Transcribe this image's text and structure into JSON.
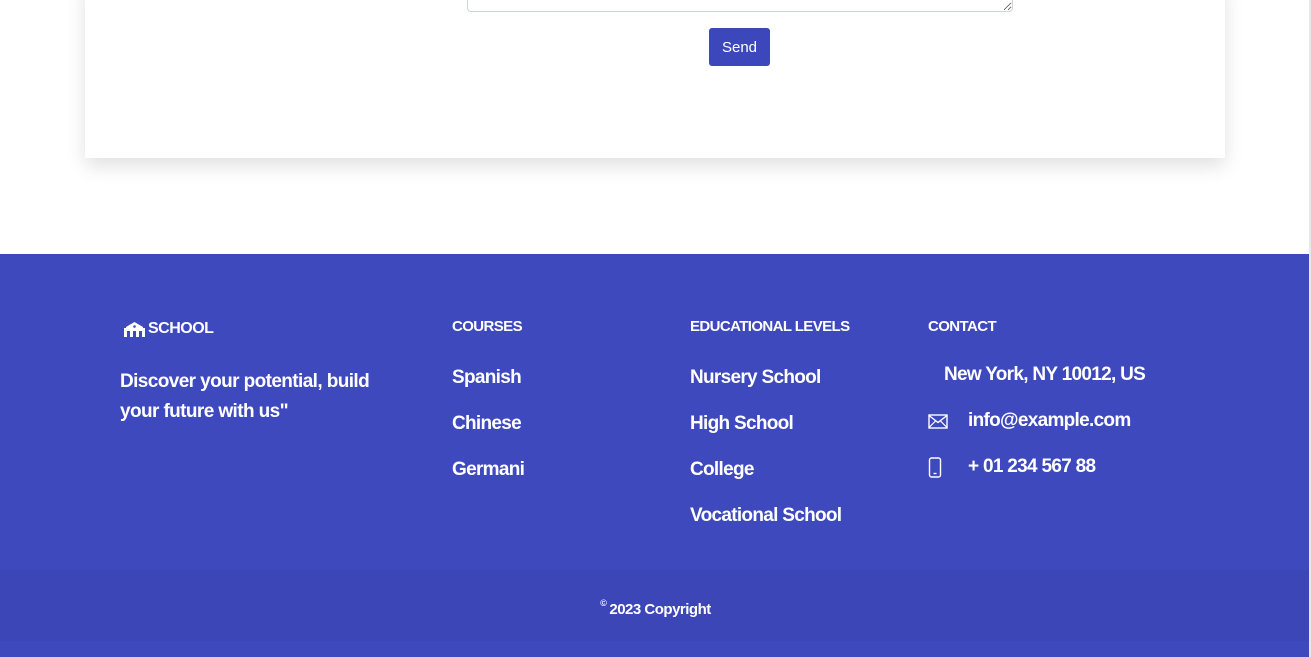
{
  "contact_form": {
    "message_value": "",
    "send_label": "Send"
  },
  "footer": {
    "brand": {
      "name": "SCHOOL",
      "icon": "school-icon"
    },
    "tagline": "Discover your potential, build your future with us\"",
    "courses": {
      "title": "COURSES",
      "items": [
        "Spanish",
        "Chinese",
        "Germani"
      ]
    },
    "levels": {
      "title": "EDUCATIONAL LEVELS",
      "items": [
        "Nursery School",
        "High School",
        "College",
        "Vocational School"
      ]
    },
    "contact": {
      "title": "CONTACT",
      "address": "New York, NY 10012, US",
      "email": "info@example.com",
      "email_icon": "envelope-icon",
      "phone": "+ 01 234 567 88",
      "phone_icon": "phone-icon"
    },
    "copyright": {
      "symbol": "©",
      "text": "2023 Copyright"
    }
  },
  "colors": {
    "footer_bg": "#3e49bd",
    "copyright_bg": "#3c46b6",
    "button_bg": "#3c47bb",
    "text_light": "#ffffff"
  }
}
